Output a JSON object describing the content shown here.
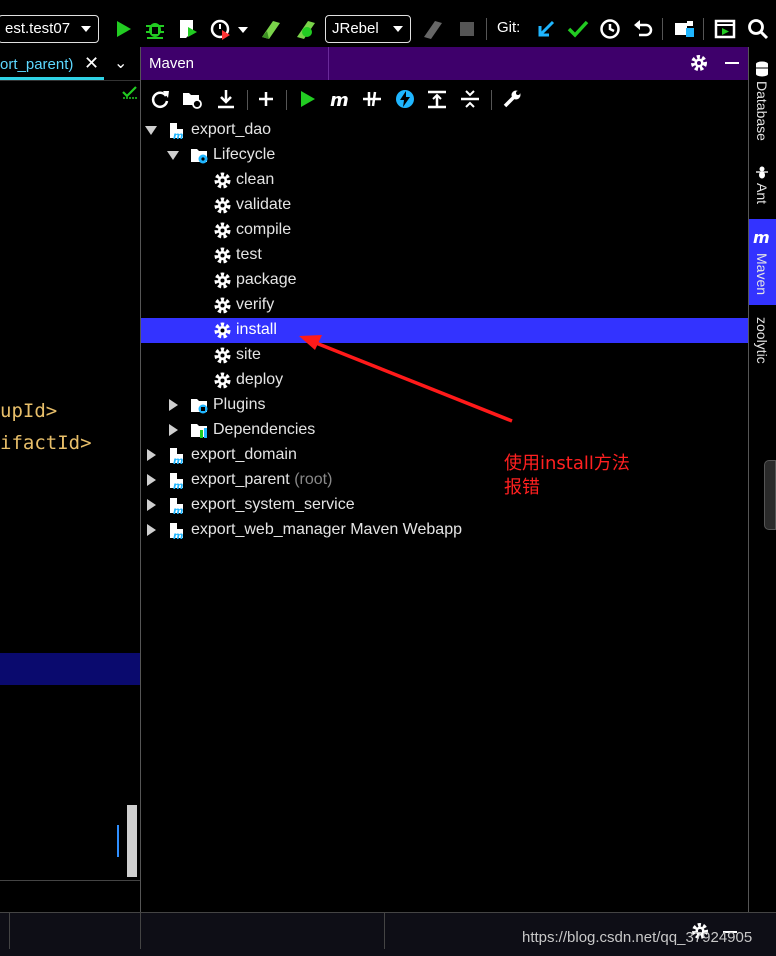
{
  "toolbar": {
    "run_config": "est.test07",
    "jrebel": "JRebel",
    "git_label": "Git:"
  },
  "editor": {
    "tab_label": "ort_parent)",
    "tab_close": "✕",
    "tab_menu": "⌄",
    "code_line_1": "upId>",
    "code_line_2": "ifactId>"
  },
  "maven": {
    "title": "Maven",
    "tree": [
      {
        "label": "export_dao",
        "suffix": ""
      },
      {
        "label": "Lifecycle",
        "suffix": ""
      },
      {
        "label": "clean",
        "suffix": ""
      },
      {
        "label": "validate",
        "suffix": ""
      },
      {
        "label": "compile",
        "suffix": ""
      },
      {
        "label": "test",
        "suffix": ""
      },
      {
        "label": "package",
        "suffix": ""
      },
      {
        "label": "verify",
        "suffix": ""
      },
      {
        "label": "install",
        "suffix": ""
      },
      {
        "label": "site",
        "suffix": ""
      },
      {
        "label": "deploy",
        "suffix": ""
      },
      {
        "label": "Plugins",
        "suffix": ""
      },
      {
        "label": "Dependencies",
        "suffix": ""
      },
      {
        "label": "export_domain",
        "suffix": ""
      },
      {
        "label": "export_parent",
        "suffix": "(root)"
      },
      {
        "label": "export_system_service",
        "suffix": ""
      },
      {
        "label": "export_web_manager Maven Webapp",
        "suffix": ""
      }
    ],
    "annotation_line_1": "使用install方法",
    "annotation_line_2": "报错"
  },
  "side_tools": {
    "database": "Database",
    "ant": "Ant",
    "maven": "Maven",
    "zoolytic": "zoolytic"
  },
  "status": {
    "watermark": "https://blog.csdn.net/qq_37924905"
  },
  "colors": {
    "maven_header": "#3e006b",
    "selection": "#3333ff",
    "annotation": "#ff2020",
    "run_green": "#22cc22"
  }
}
